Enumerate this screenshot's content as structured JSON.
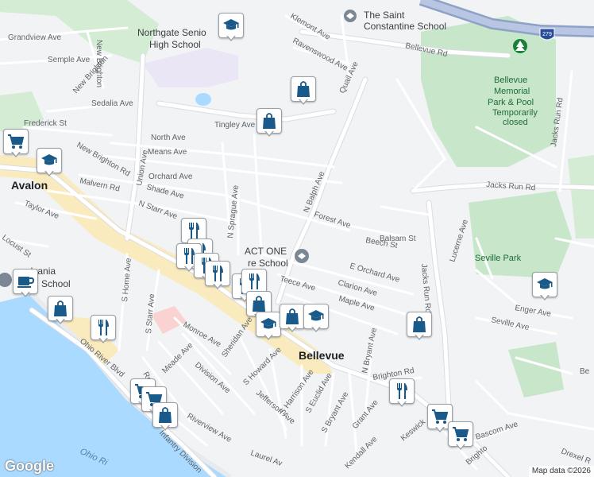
{
  "colors": {
    "land": "#f1f3f4",
    "road": "#ffffff",
    "road_outline": "#dadce0",
    "highway": "#8ea1c7",
    "water": "#aadaff",
    "park": "#c8e6c9",
    "school_area": "#f3e8ff",
    "commercial": "#fce8b2",
    "marker_icon": "#1a5a8a"
  },
  "places": {
    "town_avalon": "Avalon",
    "town_bellevue": "Bellevue",
    "river": "Ohio Ri",
    "school_northgate_1": "Northgate Senio",
    "school_northgate_2": "High School",
    "school_saint": "The Saint",
    "school_constantine": "Constantine School",
    "park_bellevue_1": "Bellevue",
    "park_bellevue_2": "Memorial",
    "park_bellevue_3": "Park & Pool",
    "park_bellevue_4": "Temporarily",
    "park_bellevue_5": "closed",
    "park_seville": "Seville Park",
    "poi_act_one_1": "ACT ONE",
    "poi_act_one_2": "re School",
    "school_sylvania_1": "nsylvania",
    "school_sylvania_2": "smith School",
    "highway_shield": "279"
  },
  "streets": {
    "grandview": "Grandview Ave",
    "semple": "Semple Ave",
    "new_brighton_top": "New Brighton",
    "new_brighton_mid": "New Brighton Rd",
    "sedalia": "Sedalia Ave",
    "frederick": "Frederick St",
    "north": "North Ave",
    "means": "Means Ave",
    "orchard": "Orchard Ave",
    "malvern": "Malvern Rd",
    "shade": "Shade Ave",
    "union": "Union Ave",
    "n_starr": "N Starr Ave",
    "taylor": "Taylor Ave",
    "locust": "Locust St",
    "tingley": "Tingley Ave",
    "klemont": "Klemont Ave",
    "ravenswood": "Ravenswood Ave",
    "quail": "Quail Ave",
    "bellevue_rd": "Bellevue Rd",
    "n_balph": "N Balph Ave",
    "forest": "Forest Ave",
    "balsam": "Balsam St",
    "beech": "Beech St",
    "jacks_run_rd": "Jacks Run Rd",
    "jacks_run_vert": "Jacks Run Rd",
    "jacks_run_lower": "Jacks Run Rd",
    "n_sprague": "N Sprague Ave",
    "e_orchard": "E Orchard Ave",
    "clarion": "Clarion Ave",
    "maple": "Maple Ave",
    "teece": "Teece Ave",
    "lucerne": "Lucerne Ave",
    "enger": "Enger Ave",
    "seville_ave": "Seville Ave",
    "s_home": "S Home Ave",
    "s_starr": "S Starr Ave",
    "monroe": "Monroe Ave",
    "meade": "Meade Ave",
    "division": "Division Ave",
    "roosevelt": "Roosevelt",
    "sheridan": "Sheridan Ave",
    "s_howard": "S Howard Ave",
    "n_bryant": "N Bryant Ave",
    "brighton_rd": "Brighton Rd",
    "s_harrison": "S Harrison Ave",
    "s_euclid": "S Euclid Ave",
    "s_bryant": "S Bryant Ave",
    "grant": "Grant Ave",
    "jefferson": "Jefferson Ave",
    "riverview": "Riverview Ave",
    "laurel": "Laurel Av",
    "kendall": "Kendall Ave",
    "keswick": "Keswick",
    "bascom": "Bascom Ave",
    "drexel": "Drexel R",
    "be": "Be",
    "ohio_river_blvd": "Ohio River Blvd",
    "infantry": "Infantry Division",
    "brighto": "Brighto"
  },
  "markers": [
    {
      "type": "school",
      "icon": "graduation-cap-icon"
    },
    {
      "type": "shopping",
      "icon": "shopping-bag-icon"
    },
    {
      "type": "shopping",
      "icon": "shopping-bag-icon"
    },
    {
      "type": "grocery",
      "icon": "shopping-cart-icon"
    },
    {
      "type": "school",
      "icon": "graduation-cap-icon"
    },
    {
      "type": "restaurant",
      "icon": "fork-knife-icon"
    },
    {
      "type": "restaurant",
      "icon": "fork-knife-icon"
    },
    {
      "type": "restaurant",
      "icon": "fork-knife-icon"
    },
    {
      "type": "restaurant",
      "icon": "fork-knife-icon"
    },
    {
      "type": "restaurant",
      "icon": "fork-knife-icon"
    },
    {
      "type": "restaurant",
      "icon": "fork-knife-icon"
    },
    {
      "type": "restaurant",
      "icon": "fork-knife-icon"
    },
    {
      "type": "shopping",
      "icon": "shopping-bag-icon"
    },
    {
      "type": "school",
      "icon": "graduation-cap-icon"
    },
    {
      "type": "shopping",
      "icon": "shopping-bag-icon"
    },
    {
      "type": "school",
      "icon": "graduation-cap-icon"
    },
    {
      "type": "cafe",
      "icon": "coffee-cup-icon"
    },
    {
      "type": "shopping",
      "icon": "shopping-bag-icon"
    },
    {
      "type": "restaurant",
      "icon": "fork-knife-icon"
    },
    {
      "type": "grocery",
      "icon": "shopping-cart-icon"
    },
    {
      "type": "grocery",
      "icon": "shopping-cart-icon"
    },
    {
      "type": "shopping",
      "icon": "shopping-bag-icon"
    },
    {
      "type": "shopping",
      "icon": "shopping-bag-icon"
    },
    {
      "type": "restaurant",
      "icon": "fork-knife-icon"
    },
    {
      "type": "grocery",
      "icon": "shopping-cart-icon"
    },
    {
      "type": "grocery",
      "icon": "shopping-cart-icon"
    },
    {
      "type": "school",
      "icon": "graduation-cap-icon"
    }
  ],
  "google_logo": "Google",
  "attribution": "Map data ©2026"
}
